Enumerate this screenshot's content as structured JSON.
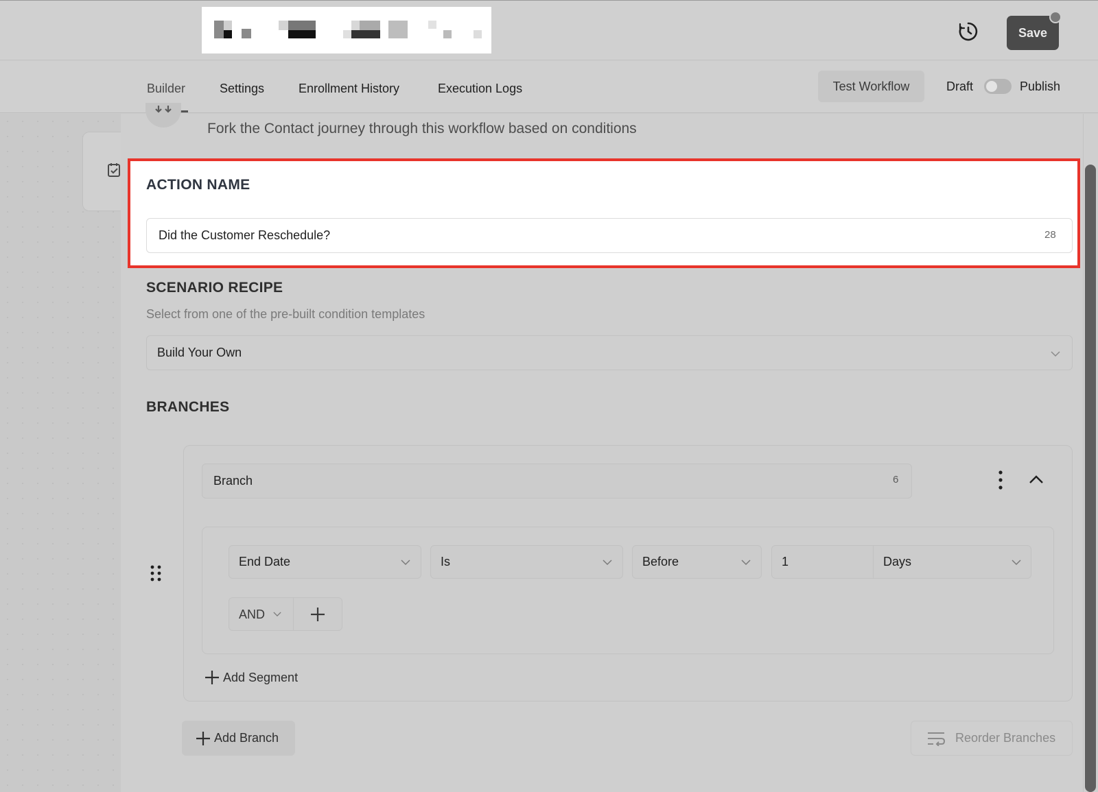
{
  "header": {
    "save_label": "Save"
  },
  "tabs": [
    {
      "label": "Builder"
    },
    {
      "label": "Settings"
    },
    {
      "label": "Enrollment History"
    },
    {
      "label": "Execution Logs"
    }
  ],
  "toolbar": {
    "test_workflow_label": "Test Workflow",
    "draft_label": "Draft",
    "publish_label": "Publish",
    "publish_on": false
  },
  "node": {
    "description": "Fork the Contact journey through this workflow based on conditions"
  },
  "action_name": {
    "title": "ACTION NAME",
    "value": "Did the Customer Reschedule?",
    "char_count": "28"
  },
  "scenario_recipe": {
    "title": "SCENARIO RECIPE",
    "subtitle": "Select from one of the pre-built condition templates",
    "selected": "Build Your Own"
  },
  "branches": {
    "title": "BRANCHES",
    "items": [
      {
        "name": "Branch",
        "char_count": "6",
        "condition": {
          "field": "End Date",
          "operator": "Is",
          "relation": "Before",
          "amount": "1",
          "unit": "Days"
        },
        "join": "AND"
      }
    ],
    "add_segment_label": "Add Segment",
    "add_branch_label": "Add Branch",
    "reorder_label": "Reorder Branches"
  },
  "colors": {
    "highlight": "#e8342b",
    "save_bg": "#4a4a4a"
  },
  "icons": [
    "history-icon",
    "calendar-check-icon",
    "fork-icon",
    "kebab-icon",
    "chevron-up-icon",
    "chevron-down-icon",
    "drag-handle-icon",
    "plus-icon",
    "reorder-icon"
  ]
}
